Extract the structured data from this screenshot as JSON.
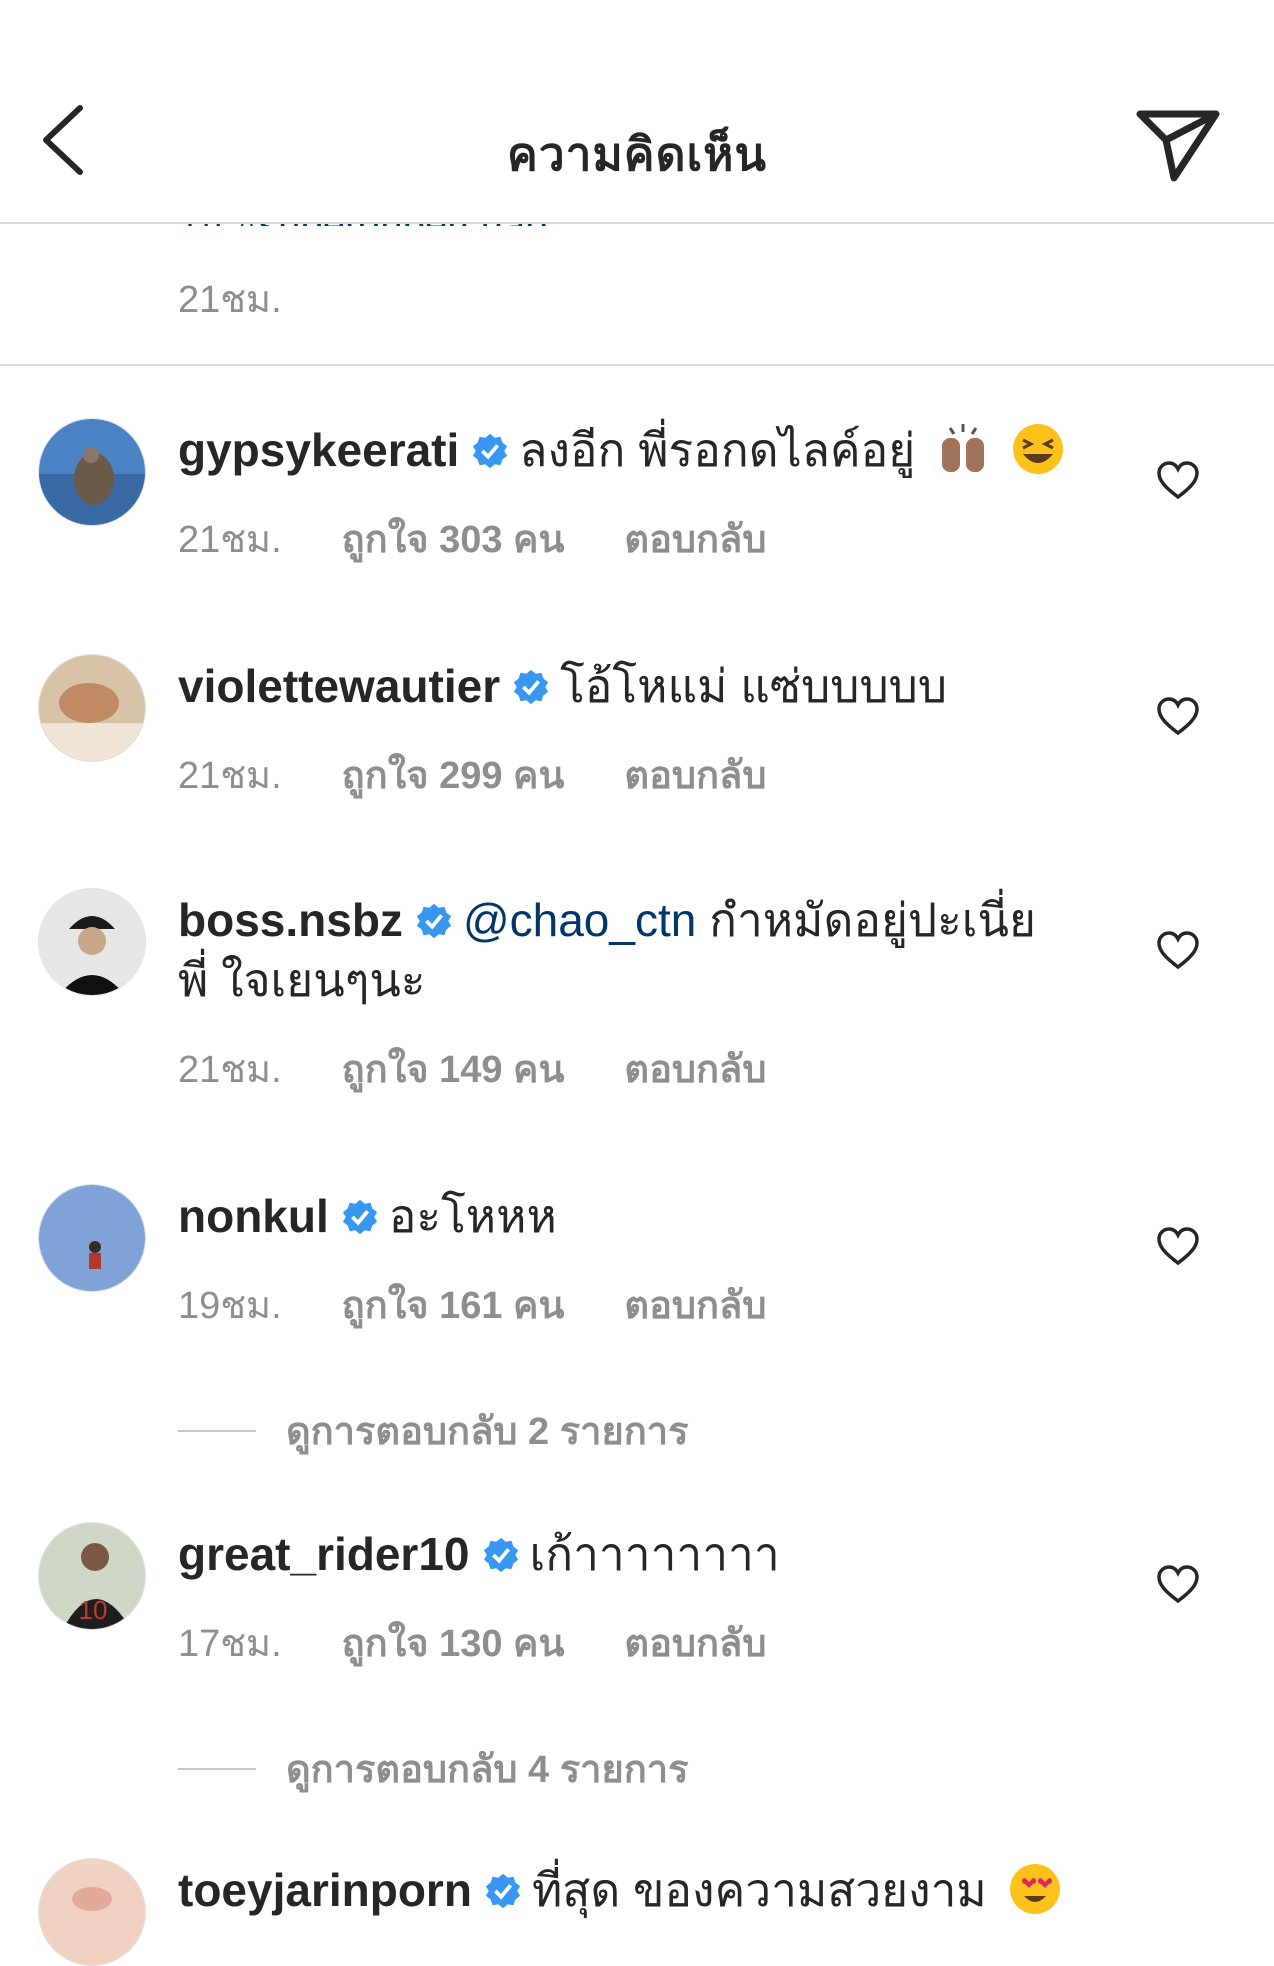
{
  "header": {
    "title": "ความคิดเห็น",
    "back_icon": "back-chevron-icon",
    "send_icon": "send-paper-plane-icon"
  },
  "caption": {
    "partial_text": "ใน #superduperchap",
    "time": "21ชม."
  },
  "comments": [
    {
      "username": "gypsykeerati",
      "text": "ลงอีก พี่รอกดไลค์อยู่",
      "emojis": [
        "raising-hands-emoji",
        "grinning-squinting-emoji"
      ],
      "time": "21ชม.",
      "likes": "ถูกใจ 303 คน",
      "reply": "ตอบกลับ"
    },
    {
      "username": "violettewautier",
      "text": "โอ้โหแม่ แซ่บบบบบ",
      "time": "21ชม.",
      "likes": "ถูกใจ 299 คน",
      "reply": "ตอบกลับ"
    },
    {
      "username": "boss.nsbz",
      "mention": "@chao_ctn",
      "text": "กำหมัดอยู่ปะเนี่ย พี่ ใจเยนๆนะ",
      "time": "21ชม.",
      "likes": "ถูกใจ 149 คน",
      "reply": "ตอบกลับ"
    },
    {
      "username": "nonkul",
      "text": "อะโหหห",
      "time": "19ชม.",
      "likes": "ถูกใจ 161 คน",
      "reply": "ตอบกลับ",
      "view_replies": "ดูการตอบกลับ 2 รายการ"
    },
    {
      "username": "great_rider10",
      "text": "เก้าาาาาาาา",
      "time": "17ชม.",
      "likes": "ถูกใจ 130 คน",
      "reply": "ตอบกลับ",
      "view_replies": "ดูการตอบกลับ 4 รายการ"
    },
    {
      "username": "toeyjarinporn",
      "text": "ที่สุด ของความสวยงาม",
      "emojis": [
        "heart-eyes-emoji"
      ]
    }
  ],
  "colors": {
    "text": "#262626",
    "secondary": "#8e8e8e",
    "mention": "#00376b",
    "verified": "#3897f0",
    "divider": "#dbdbdb"
  }
}
